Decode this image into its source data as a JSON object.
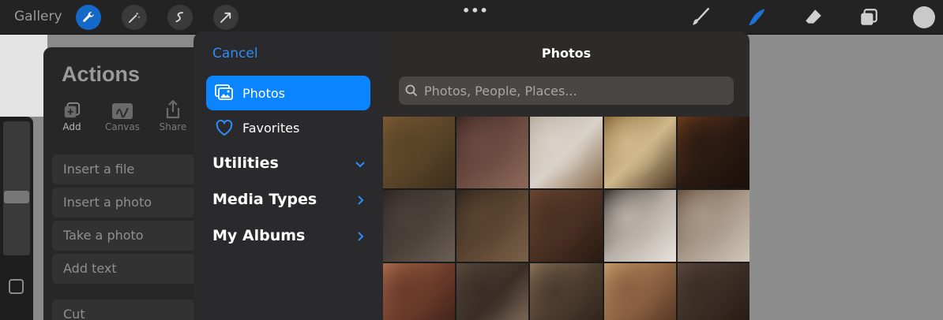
{
  "toolbar": {
    "gallery_label": "Gallery",
    "left_tools": [
      "wrench-icon",
      "magic-wand-icon",
      "selection-icon",
      "transform-arrow-icon"
    ],
    "more_label": "•••",
    "right_tools": [
      "brush-icon",
      "smudge-icon",
      "eraser-icon",
      "layers-icon"
    ],
    "accent": "#1468c8"
  },
  "actions": {
    "title": "Actions",
    "tabs": [
      {
        "label": "Add",
        "icon": "add-icon"
      },
      {
        "label": "Canvas",
        "icon": "canvas-icon"
      },
      {
        "label": "Share",
        "icon": "share-icon"
      }
    ],
    "items": [
      "Insert a file",
      "Insert a photo",
      "Take a photo",
      "Add text",
      "Cut"
    ]
  },
  "picker": {
    "cancel_label": "Cancel",
    "title": "Photos",
    "search_placeholder": "Photos, People, Places...",
    "nav": [
      {
        "label": "Photos",
        "icon": "photos-icon",
        "selected": true
      },
      {
        "label": "Favorites",
        "icon": "heart-icon",
        "selected": false
      }
    ],
    "sections": [
      {
        "label": "Utilities",
        "icon": "chevron-down-icon"
      },
      {
        "label": "Media Types",
        "icon": "chevron-right-icon"
      },
      {
        "label": "My Albums",
        "icon": "chevron-right-icon"
      }
    ],
    "accent": "#0a84ff"
  },
  "photos": [
    {
      "name": "forest-painting",
      "colors": [
        "#5a4428",
        "#7a5a32",
        "#3d2f1c"
      ]
    },
    {
      "name": "letters-stack",
      "colors": [
        "#6b4a40",
        "#3e2a24",
        "#8c6a5a"
      ]
    },
    {
      "name": "wax-seal",
      "colors": [
        "#d9d2c8",
        "#b8aca0",
        "#8a6a4a"
      ]
    },
    {
      "name": "hands-with-paper",
      "colors": [
        "#cfb88a",
        "#8a6a3a",
        "#4a3520"
      ]
    },
    {
      "name": "candles",
      "colors": [
        "#2a1a12",
        "#6a3a1a",
        "#1a100a"
      ]
    },
    {
      "name": "quill-and-letters",
      "colors": [
        "#4a403a",
        "#2e2622",
        "#6a5e54"
      ]
    },
    {
      "name": "typewriter-shelf",
      "colors": [
        "#5a4430",
        "#2e241c",
        "#7a6048"
      ]
    },
    {
      "name": "library-shelves",
      "colors": [
        "#4a3022",
        "#6a4630",
        "#2a1a12"
      ]
    },
    {
      "name": "person-in-coat",
      "colors": [
        "#b8b0a8",
        "#3a3430",
        "#e8e2dc"
      ]
    },
    {
      "name": "person-in-vest",
      "colors": [
        "#a89888",
        "#6a5240",
        "#d0c6ba"
      ]
    },
    {
      "name": "book-spines",
      "colors": [
        "#6a3a2a",
        "#a86a4a",
        "#3a2018"
      ]
    },
    {
      "name": "typewriter-desk",
      "colors": [
        "#3a2e26",
        "#5a4a3e",
        "#8a7462"
      ]
    },
    {
      "name": "old-papers",
      "colors": [
        "#4a3a2c",
        "#8a7058",
        "#2a2018"
      ]
    },
    {
      "name": "coffee-and-book",
      "colors": [
        "#8a6040",
        "#c49a6a",
        "#4a3020"
      ]
    },
    {
      "name": "scattered-books",
      "colors": [
        "#3a2c24",
        "#5a463a",
        "#22180f"
      ]
    }
  ]
}
